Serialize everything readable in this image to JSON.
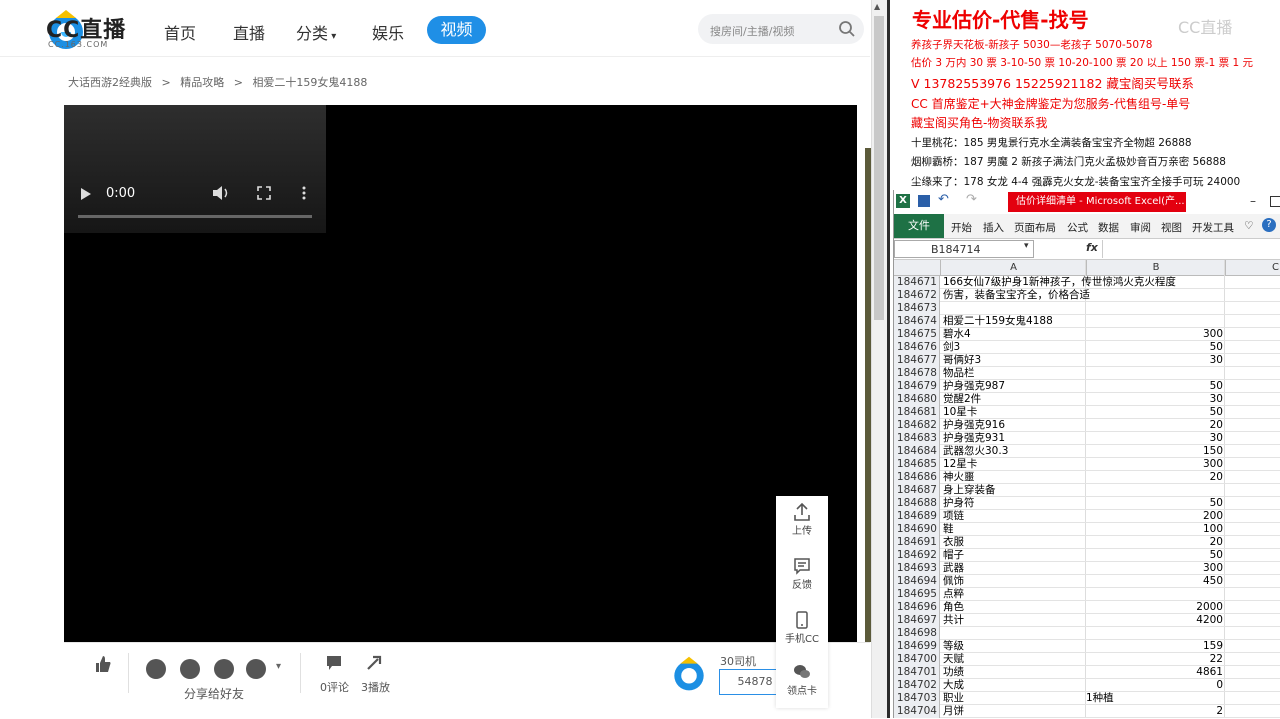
{
  "header": {
    "logo_text": "CC直播",
    "logo_sub": "CC.163.COM",
    "nav": [
      "首页",
      "直播",
      "分类",
      "娱乐"
    ],
    "nav_active": "视频",
    "search_placeholder": "搜房间/主播/视频"
  },
  "breadcrumb": [
    "大话西游2经典版",
    ">",
    "精品攻略",
    ">",
    "相爱二十159女鬼4188"
  ],
  "video": {
    "time": "0:00"
  },
  "toolbar": {
    "share_label": "分享给好友",
    "comment_label": "0评论",
    "play_label": "3播放",
    "user_name": "30司机",
    "user_id": "54878"
  },
  "side": {
    "upload": "上传",
    "feedback": "反馈",
    "mobile": "手机CC",
    "card": "领点卡"
  },
  "doc": {
    "title": "专业估价-代售-找号",
    "watermark": "CC直播",
    "lines": [
      {
        "text": "养孩子界天花板-新孩子 5030—老孩子 5070-5078",
        "color": "red"
      },
      {
        "text": "估价 3 万内 30 票 3-10-50 票 10-20-100 票 20 以上 150 票-1 票 1 元",
        "color": "red"
      },
      {
        "text": "V 13782553976 15225921182 藏宝阁买号联系",
        "color": "red"
      },
      {
        "text": "CC 首席鉴定+大神金牌鉴定为您服务-代售组号-单号",
        "color": "red"
      },
      {
        "text": "藏宝阁买角色-物资联系我",
        "color": "red"
      },
      {
        "text": "十里桃花：185 男鬼景行克水全满装备宝宝齐全物超 26888",
        "color": "black"
      },
      {
        "text": "烟柳霸桥：187 男魔 2 新孩子满法门克火孟极妙音百万亲密 56888",
        "color": "black"
      },
      {
        "text": "尘缘来了：178 女龙 4-4 强霹克火女龙-装备宝宝齐全接手可玩 24000",
        "color": "black"
      }
    ]
  },
  "excel": {
    "title": "估价详细清单 - Microsoft Excel(产...",
    "file_tab": "文件",
    "tabs": [
      "开始",
      "插入",
      "页面布局",
      "公式",
      "数据",
      "审阅",
      "视图",
      "开发工具"
    ],
    "name_box": "B184714",
    "fx": "fx",
    "col_headers": [
      "A",
      "B",
      "C"
    ],
    "rows": [
      {
        "n": "184671",
        "a": "166女仙7级护身1新神孩子，传世惊鸿火克火程度",
        "b": ""
      },
      {
        "n": "184672",
        "a": "伤害，装备宝宝齐全，价格合适",
        "b": ""
      },
      {
        "n": "184673",
        "a": "",
        "b": ""
      },
      {
        "n": "184674",
        "a": "相爱二十159女鬼4188",
        "b": ""
      },
      {
        "n": "184675",
        "a": "碧水4",
        "b": "300"
      },
      {
        "n": "184676",
        "a": "剑3",
        "b": "50"
      },
      {
        "n": "184677",
        "a": "哥俩好3",
        "b": "30"
      },
      {
        "n": "184678",
        "a": "物品栏",
        "b": ""
      },
      {
        "n": "184679",
        "a": "护身强克987",
        "b": "50"
      },
      {
        "n": "184680",
        "a": "觉醒2件",
        "b": "30"
      },
      {
        "n": "184681",
        "a": "10星卡",
        "b": "50"
      },
      {
        "n": "184682",
        "a": "护身强克916",
        "b": "20"
      },
      {
        "n": "184683",
        "a": "护身强克931",
        "b": "30"
      },
      {
        "n": "184684",
        "a": "武器忽火30.3",
        "b": "150"
      },
      {
        "n": "184685",
        "a": "12星卡",
        "b": "300"
      },
      {
        "n": "184686",
        "a": "神火噩",
        "b": "20"
      },
      {
        "n": "184687",
        "a": "身上穿装备",
        "b": ""
      },
      {
        "n": "184688",
        "a": "护身符",
        "b": "50"
      },
      {
        "n": "184689",
        "a": "项链",
        "b": "200"
      },
      {
        "n": "184690",
        "a": "鞋",
        "b": "100"
      },
      {
        "n": "184691",
        "a": "衣服",
        "b": "20"
      },
      {
        "n": "184692",
        "a": "帽子",
        "b": "50"
      },
      {
        "n": "184693",
        "a": "武器",
        "b": "300"
      },
      {
        "n": "184694",
        "a": "佩饰",
        "b": "450"
      },
      {
        "n": "184695",
        "a": "点粹",
        "b": ""
      },
      {
        "n": "184696",
        "a": "角色",
        "b": "2000"
      },
      {
        "n": "184697",
        "a": "共计",
        "b": "4200"
      },
      {
        "n": "184698",
        "a": "",
        "b": ""
      },
      {
        "n": "184699",
        "a": "等级",
        "b": "159"
      },
      {
        "n": "184700",
        "a": "天赋",
        "b": "22"
      },
      {
        "n": "184701",
        "a": "功绩",
        "b": "4861"
      },
      {
        "n": "184702",
        "a": "大成",
        "b": "0"
      },
      {
        "n": "184703",
        "a": "职业",
        "b": "1种植"
      },
      {
        "n": "184704",
        "a": "月饼",
        "b": "2"
      }
    ]
  }
}
